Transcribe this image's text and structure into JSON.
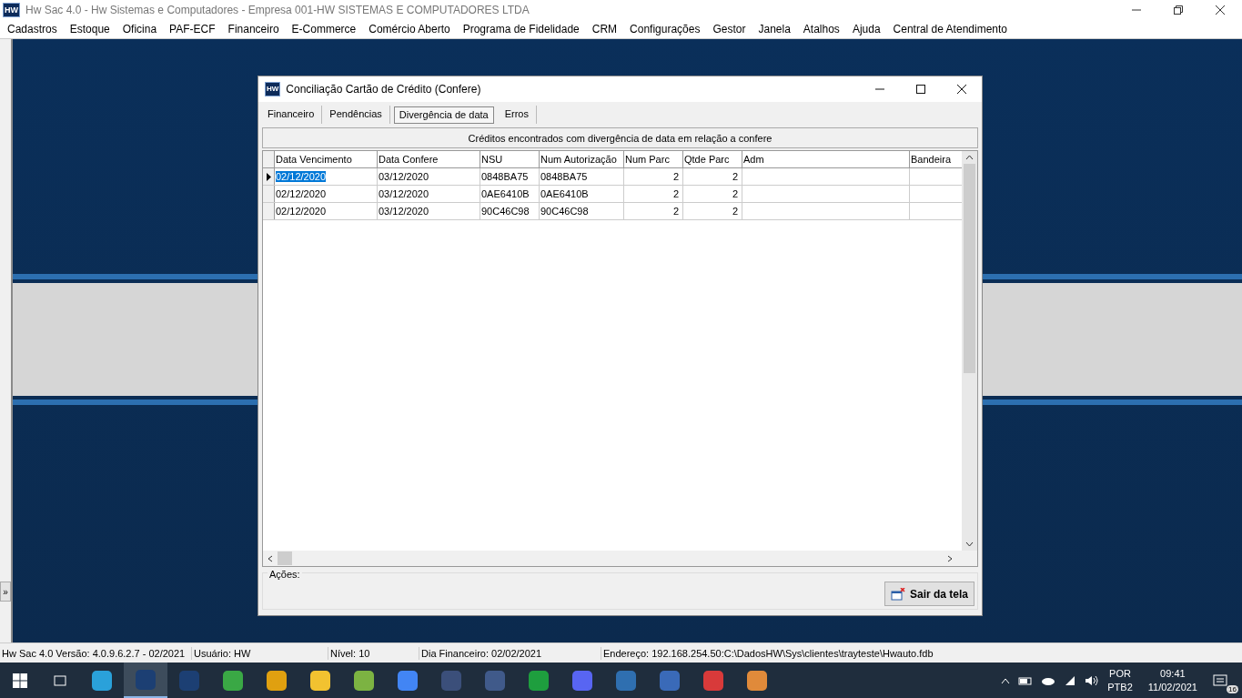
{
  "window": {
    "logo": "HW",
    "side_button": "»",
    "title": "Hw Sac 4.0 - Hw Sistemas e Computadores - Empresa 001-HW SISTEMAS E COMPUTADORES LTDA"
  },
  "menu": [
    "Cadastros",
    "Estoque",
    "Oficina",
    "PAF-ECF",
    "Financeiro",
    "E-Commerce",
    "Comércio Aberto",
    "Programa de Fidelidade",
    "CRM",
    "Configurações",
    "Gestor",
    "Janela",
    "Atalhos",
    "Ajuda",
    "Central de Atendimento"
  ],
  "dialog": {
    "logo": "HW",
    "title": "Conciliação Cartão de Crédito (Confere)",
    "tabs": [
      {
        "label": "Financeiro",
        "selected": false
      },
      {
        "label": "Pendências",
        "selected": false
      },
      {
        "label": "Divergência de data",
        "selected": true
      },
      {
        "label": "Erros",
        "selected": false
      }
    ],
    "caption": "Créditos encontrados com divergência de data em relação a confere",
    "table": {
      "columns": [
        {
          "label": "Data Vencimento",
          "kind": "text"
        },
        {
          "label": "Data Confere",
          "kind": "text"
        },
        {
          "label": "NSU",
          "kind": "text"
        },
        {
          "label": "Num Autorização",
          "kind": "text"
        },
        {
          "label": "Num Parc",
          "kind": "number"
        },
        {
          "label": "Qtde Parc",
          "kind": "number"
        },
        {
          "label": "Adm",
          "kind": "text"
        },
        {
          "label": "Bandeira",
          "kind": "text"
        }
      ],
      "rows": [
        {
          "selected": true,
          "cells": [
            "02/12/2020",
            "03/12/2020",
            "0848BA75",
            "0848BA75",
            "2",
            "2",
            "",
            ""
          ]
        },
        {
          "selected": false,
          "cells": [
            "02/12/2020",
            "03/12/2020",
            "0AE6410B",
            "0AE6410B",
            "2",
            "2",
            "",
            ""
          ]
        },
        {
          "selected": false,
          "cells": [
            "02/12/2020",
            "03/12/2020",
            "90C46C98",
            "90C46C98",
            "2",
            "2",
            "",
            ""
          ]
        }
      ]
    },
    "actions_label": "Ações:",
    "exit_button": "Sair da tela"
  },
  "status_bar": [
    "Hw Sac 4.0 Versão: 4.0.9.6.2.7 - 02/2021",
    "Usuário: HW",
    "Nível: 10",
    "Dia Financeiro: 02/02/2021",
    "Endereço: 192.168.254.50:C:\\DadosHW\\Sys\\clientes\\trayteste\\Hwauto.fdb"
  ],
  "taskbar": {
    "apps": [
      {
        "color": "#2aa1da",
        "active": false
      },
      {
        "color": "#1c3f73",
        "active": true
      },
      {
        "color": "#1c3f73",
        "active": false
      },
      {
        "color": "#3aa845",
        "active": false
      },
      {
        "color": "#e0a010",
        "active": false
      },
      {
        "color": "#f2c230",
        "active": false
      },
      {
        "color": "#7cb342",
        "active": false
      },
      {
        "color": "#4285f4",
        "active": false
      },
      {
        "color": "#3b4f7a",
        "active": false
      },
      {
        "color": "#405a8a",
        "active": false
      },
      {
        "color": "#1e9e3e",
        "active": false
      },
      {
        "color": "#5865f2",
        "active": false
      },
      {
        "color": "#2f6fb0",
        "active": false
      },
      {
        "color": "#3a6ab8",
        "active": false
      },
      {
        "color": "#d83a3a",
        "active": false
      },
      {
        "color": "#e08a3a",
        "active": false
      }
    ],
    "lang": "POR",
    "layout": "PTB2",
    "time": "09:41",
    "date": "11/02/2021",
    "notifications": "16"
  }
}
